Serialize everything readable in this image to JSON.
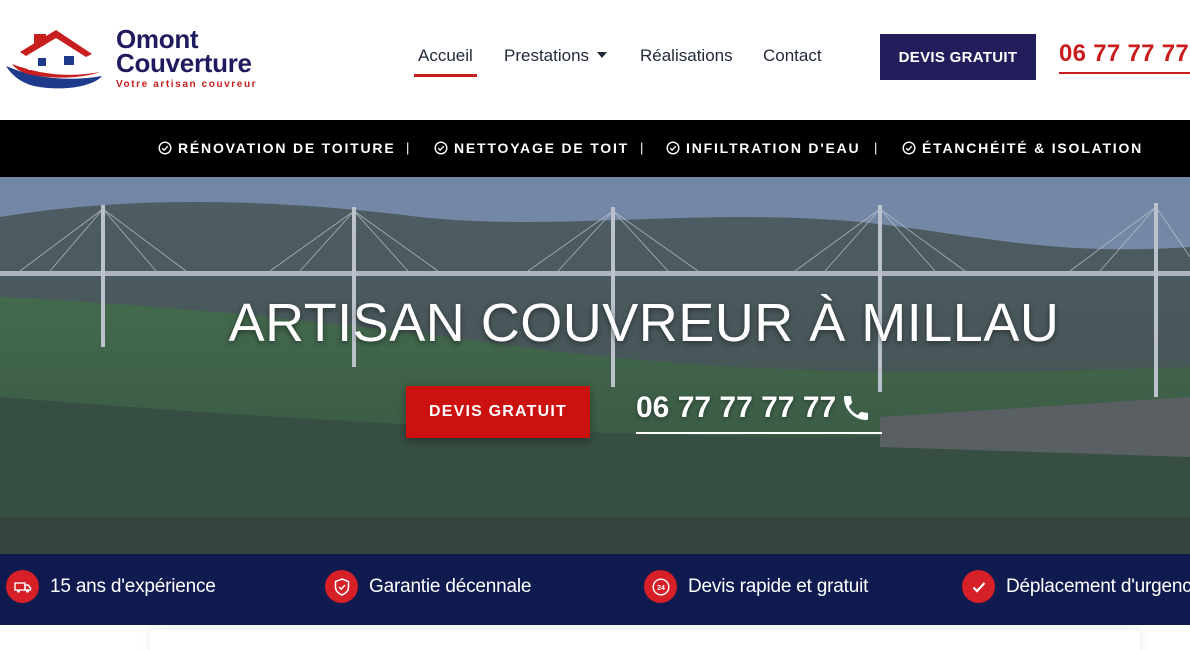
{
  "header": {
    "logo": {
      "line1": "Omont",
      "line2": "Couverture",
      "tagline": "Votre artisan couvreur",
      "icon": "house-roof-logo-icon"
    },
    "nav": [
      {
        "label": "Accueil",
        "active": true
      },
      {
        "label": "Prestations",
        "active": false,
        "has_dropdown": true
      },
      {
        "label": "Réalisations",
        "active": false
      },
      {
        "label": "Contact",
        "active": false
      }
    ],
    "cta_label": "DEVIS GRATUIT",
    "phone": "06 77 77 77"
  },
  "service_bar": {
    "items": [
      {
        "label": "RÉNOVATION DE TOITURE",
        "icon": "check-circle-icon"
      },
      {
        "label": "NETTOYAGE DE TOIT",
        "icon": "check-circle-icon"
      },
      {
        "label": "INFILTRATION D'EAU",
        "icon": "check-circle-icon"
      },
      {
        "label": "ÉTANCHÉITÉ & ISOLATION",
        "icon": "check-circle-icon"
      }
    ],
    "separator": "|"
  },
  "hero": {
    "title": "ARTISAN COUVREUR À MILLAU",
    "cta_label": "DEVIS GRATUIT",
    "phone": "06 77 77 77 77",
    "phone_icon": "phone-icon"
  },
  "features": [
    {
      "label": "15 ans d'expérience",
      "icon": "truck-icon"
    },
    {
      "label": "Garantie décennale",
      "icon": "shield-icon"
    },
    {
      "label": "Devis rapide et gratuit",
      "icon": "24h-icon"
    },
    {
      "label": "Déplacement d'urgence",
      "icon": "check-icon"
    }
  ],
  "colors": {
    "brand_navy": "#221e5c",
    "brand_red": "#c81e1e",
    "service_bar_bg": "#000000",
    "features_bg": "#0f1a4f",
    "hero_button": "#cc1111",
    "feature_icon_bg": "#d61f26"
  }
}
